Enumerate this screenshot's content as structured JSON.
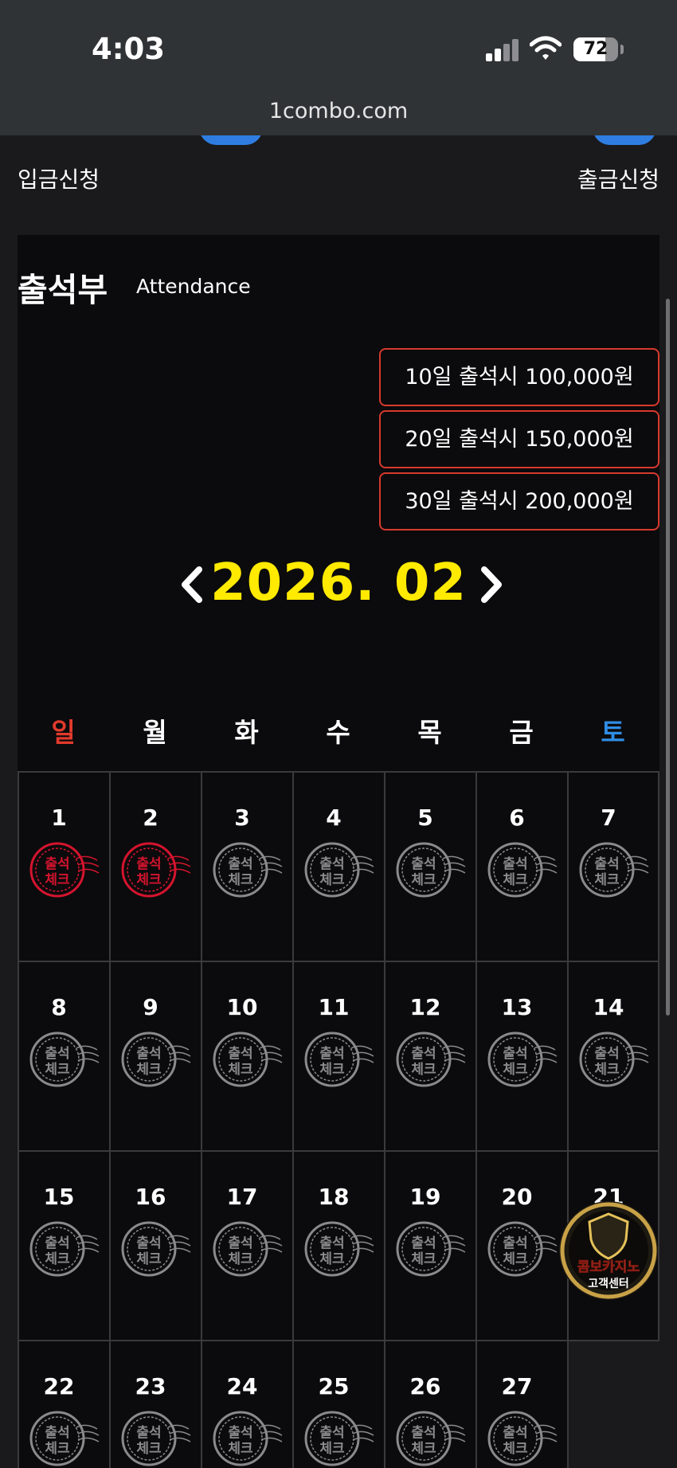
{
  "status_bar": {
    "time": "4:03",
    "battery": "72",
    "battery_level": 0.72
  },
  "browser": {
    "url": "1combo.com"
  },
  "top_actions": {
    "deposit_label": "입금신청",
    "withdraw_label": "출금신청"
  },
  "attendance": {
    "title": "출석부",
    "subtitle": "Attendance",
    "rewards": [
      "10일 출석시 100,000원",
      "20일 출석시 150,000원",
      "30일 출석시 200,000원"
    ],
    "month": "2026. 02",
    "weekdays": [
      "일",
      "월",
      "화",
      "수",
      "목",
      "금",
      "토"
    ],
    "colors": {
      "sunday": "#e23a2c",
      "saturday": "#2f8de4",
      "month": "#ffea00",
      "accent_border": "#d63a2e",
      "stamp_checked": "#d4142e",
      "stamp_unchecked": "#8a8a8c"
    },
    "stamp_text_top": "출석",
    "stamp_text_bottom": "체크",
    "days": [
      {
        "day": "1",
        "checked": true
      },
      {
        "day": "2",
        "checked": true
      },
      {
        "day": "3",
        "checked": false
      },
      {
        "day": "4",
        "checked": false
      },
      {
        "day": "5",
        "checked": false
      },
      {
        "day": "6",
        "checked": false
      },
      {
        "day": "7",
        "checked": false
      },
      {
        "day": "8",
        "checked": false
      },
      {
        "day": "9",
        "checked": false
      },
      {
        "day": "10",
        "checked": false
      },
      {
        "day": "11",
        "checked": false
      },
      {
        "day": "12",
        "checked": false
      },
      {
        "day": "13",
        "checked": false
      },
      {
        "day": "14",
        "checked": false
      },
      {
        "day": "15",
        "checked": false
      },
      {
        "day": "16",
        "checked": false
      },
      {
        "day": "17",
        "checked": false
      },
      {
        "day": "18",
        "checked": false
      },
      {
        "day": "19",
        "checked": false
      },
      {
        "day": "20",
        "checked": false
      },
      {
        "day": "21",
        "checked": false
      },
      {
        "day": "22",
        "checked": false
      },
      {
        "day": "23",
        "checked": false
      },
      {
        "day": "24",
        "checked": false
      },
      {
        "day": "25",
        "checked": false
      },
      {
        "day": "26",
        "checked": false
      },
      {
        "day": "27",
        "checked": false
      }
    ]
  },
  "support_badge": {
    "line1": "콤보카지노",
    "line2": "고객센터",
    "icon": "support-shield-icon"
  }
}
